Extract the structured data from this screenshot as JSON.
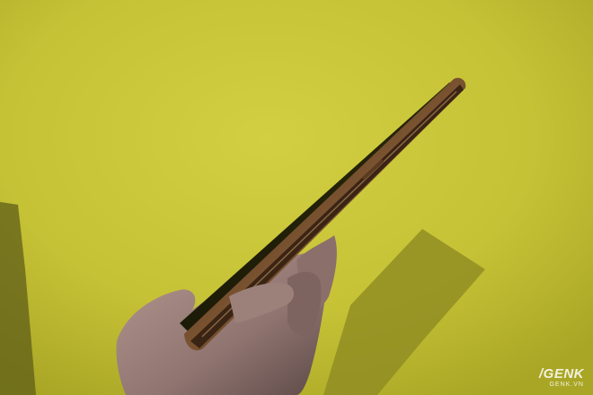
{
  "photo": {
    "subject": "smartphone-side-profile-held-in-hand",
    "background_color": "#c9c63a",
    "phone_body_color": "#1a1209",
    "phone_edge_color": "#6b4a2a",
    "skin_color": "#a98c86"
  },
  "watermark": {
    "brand": "/GENK",
    "site": "GENK.VN"
  }
}
